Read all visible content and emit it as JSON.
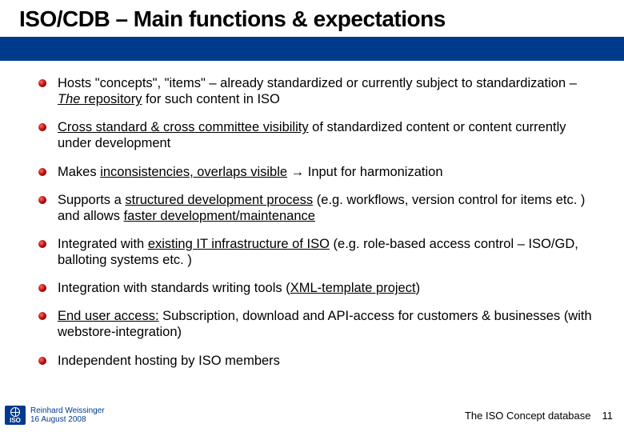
{
  "title": "ISO/CDB – Main functions & expectations",
  "bullets": {
    "b1a": "Hosts \"concepts\", \"items\" – already standardized or currently subject to standardization – ",
    "b1b": "The",
    "b1c": " repository",
    "b1d": " for such content in ISO",
    "b2a": "Cross standard & cross committee visibility",
    "b2b": " of standardized content or content currently under development",
    "b3a": "Makes ",
    "b3b": "inconsistencies, overlaps visible",
    "b3c": " → Input for harmonization",
    "b4a": "Supports a ",
    "b4b": "structured development process",
    "b4c": " (e.g. workflows, version control for items etc. ) and allows ",
    "b4d": "faster development/maintenance",
    "b5a": "Integrated with ",
    "b5b": "existing IT infrastructure of ISO",
    "b5c": " (e.g. role-based access control – ISO/GD, balloting systems etc. )",
    "b6a": "Integration with standards writing tools (",
    "b6b": "XML-template project",
    "b6c": ")",
    "b7a": "End user access:",
    "b7b": " Subscription, download and API-access for customers & businesses (with webstore-integration)",
    "b8": "Independent hosting by ISO members"
  },
  "footer": {
    "logo_text": "ISO",
    "author": "Reinhard Weissinger",
    "date": "16 August 2008",
    "doc_title": "The ISO Concept database",
    "page": "11"
  }
}
